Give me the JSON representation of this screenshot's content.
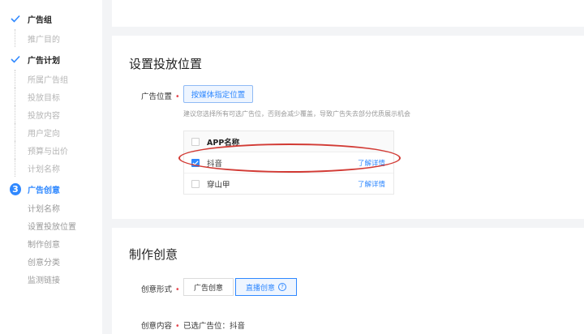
{
  "sidebar": {
    "steps": [
      {
        "label": "广告组",
        "type": "major",
        "state": "done"
      },
      {
        "label": "推广目的",
        "type": "minor"
      },
      {
        "label": "广告计划",
        "type": "major",
        "state": "done"
      },
      {
        "label": "所属广告组",
        "type": "minor"
      },
      {
        "label": "投放目标",
        "type": "minor"
      },
      {
        "label": "投放内容",
        "type": "minor"
      },
      {
        "label": "用户定向",
        "type": "minor"
      },
      {
        "label": "预算与出价",
        "type": "minor"
      },
      {
        "label": "计划名称",
        "type": "minor"
      },
      {
        "label": "广告创意",
        "type": "major",
        "state": "active",
        "number": "3"
      },
      {
        "label": "计划名称",
        "type": "sub"
      },
      {
        "label": "设置投放位置",
        "type": "sub"
      },
      {
        "label": "制作创意",
        "type": "sub"
      },
      {
        "label": "创意分类",
        "type": "sub"
      },
      {
        "label": "监测链接",
        "type": "sub"
      }
    ]
  },
  "placement": {
    "title": "设置投放位置",
    "label": "广告位置",
    "required_mark": "•",
    "media_button": "按媒体指定位置",
    "hint": "建议您选择所有可选广告位，否则会减少覆盖，导致广告失去部分优质展示机会",
    "table": {
      "header": "APP名称",
      "rows": [
        {
          "name": "抖音",
          "checked": true,
          "link": "了解详情"
        },
        {
          "name": "穿山甲",
          "checked": false,
          "link": "了解详情"
        }
      ]
    }
  },
  "creative": {
    "title": "制作创意",
    "form_label": "创意形式",
    "required_mark": "•",
    "options": [
      "广告创意",
      "直播创意"
    ],
    "help": "?",
    "content_label": "创意内容",
    "content_value": "已选广告位：抖音"
  },
  "colors": {
    "accent": "#2f88ff",
    "annotation": "#d23a34",
    "required": "#e5474f"
  }
}
